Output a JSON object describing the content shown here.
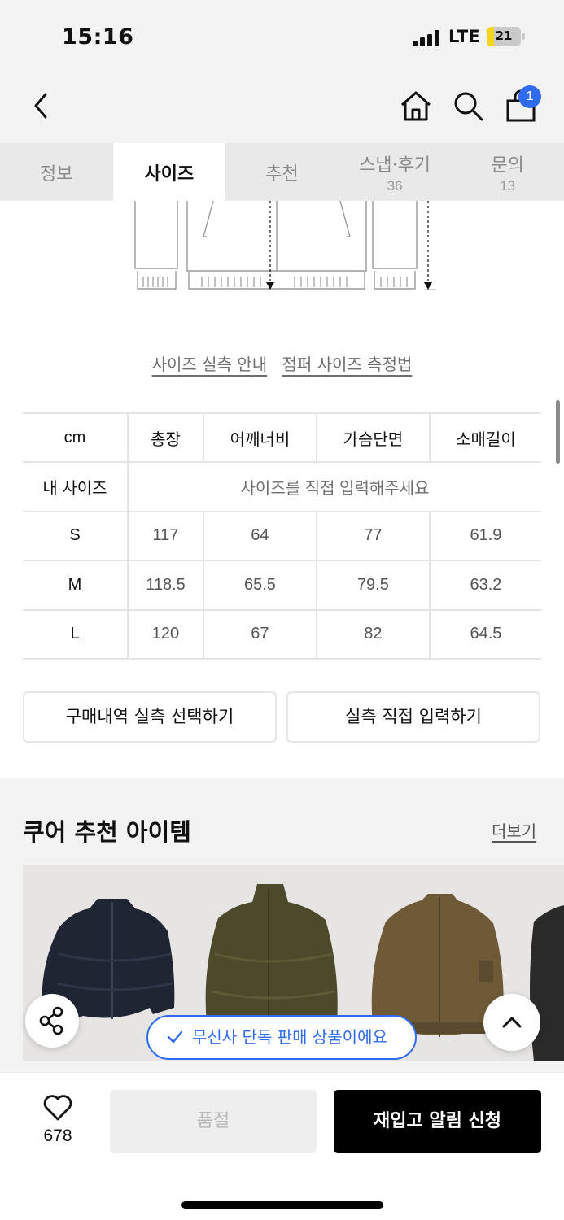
{
  "status_bar": {
    "time": "15:16",
    "network": "LTE",
    "battery": "21",
    "battery_level": 0.21,
    "battery_color": "#f4d61a"
  },
  "nav": {
    "back_icon": "chevron-left-icon",
    "home_icon": "home-icon",
    "search_icon": "search-icon",
    "cart_icon": "shopping-bag-icon",
    "cart_count": "1",
    "badge_color": "#2f6bf0"
  },
  "tabs": [
    {
      "label": "정보",
      "count": ""
    },
    {
      "label": "사이즈",
      "count": "",
      "active": true
    },
    {
      "label": "추천",
      "count": ""
    },
    {
      "label": "스냅·후기",
      "count": "36"
    },
    {
      "label": "문의",
      "count": "13"
    }
  ],
  "guide": {
    "link1": "사이즈 실측 안내",
    "link2": "점퍼 사이즈 측정법"
  },
  "size_table": {
    "headers": [
      "cm",
      "총장",
      "어깨너비",
      "가슴단면",
      "소매길이"
    ],
    "my_size_label": "내 사이즈",
    "my_size_placeholder": "사이즈를 직접 입력해주세요",
    "rows": [
      {
        "size": "S",
        "values": [
          "117",
          "64",
          "77",
          "61.9"
        ]
      },
      {
        "size": "M",
        "values": [
          "118.5",
          "65.5",
          "79.5",
          "63.2"
        ]
      },
      {
        "size": "L",
        "values": [
          "120",
          "67",
          "82",
          "64.5"
        ]
      }
    ]
  },
  "actions": {
    "purchase_history": "구매내역 실측 선택하기",
    "direct_input": "실측 직접 입력하기"
  },
  "recommendations": {
    "title": "쿠어 추천 아이템",
    "more": "더보기",
    "products": [
      {
        "name": "navy puffer jacket",
        "color": "#1f2533"
      },
      {
        "name": "khaki down jacket",
        "color": "#4d4a2c"
      },
      {
        "name": "brown bomber jacket",
        "color": "#6f5a38"
      },
      {
        "name": "charcoal jacket",
        "color": "#2a2a2a"
      }
    ]
  },
  "badges": {
    "exclusive": "무신사 단독 판매 상품이에요"
  },
  "bottom_bar": {
    "like_count": "678",
    "soldout": "품절",
    "restock": "재입고 알림 신청"
  }
}
